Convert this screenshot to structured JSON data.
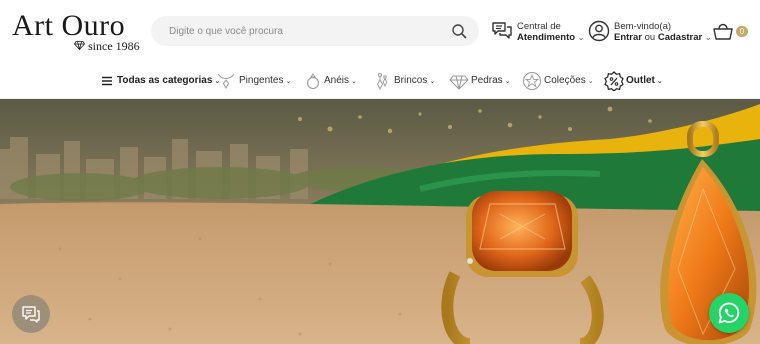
{
  "header": {
    "logo": {
      "name": "Art Ouro",
      "tagline": "since 1986"
    },
    "search": {
      "placeholder": "Digite o que você procura",
      "icon": "search-icon"
    },
    "central": {
      "line1": "Central de",
      "line2": "Atendimento",
      "icon": "chat-bubbles-icon"
    },
    "account": {
      "line1": "Bem-vindo(a)",
      "login": "Entrar",
      "or": "ou",
      "register": "Cadastrar",
      "icon": "user-icon"
    },
    "cart": {
      "count": "0",
      "icon": "basket-icon"
    }
  },
  "nav": {
    "items": [
      {
        "label": "Todas as categorias",
        "icon": "menu-icon"
      },
      {
        "label": "Pingentes",
        "icon": "pendant-icon"
      },
      {
        "label": "Anéis",
        "icon": "ring-icon"
      },
      {
        "label": "Brincos",
        "icon": "earring-icon"
      },
      {
        "label": "Pedras",
        "icon": "gem-icon"
      },
      {
        "label": "Coleções",
        "icon": "collection-icon"
      },
      {
        "label": "Outlet",
        "icon": "percent-badge-icon"
      }
    ]
  },
  "hero": {
    "image": "citrine-ring-and-pendant-banner"
  },
  "floating": {
    "chat_icon": "chat-icon",
    "whatsapp_icon": "whatsapp-icon"
  },
  "colors": {
    "accent": "#c9a86a",
    "whatsapp": "#25d366",
    "search_bg": "#f3f3f3"
  }
}
